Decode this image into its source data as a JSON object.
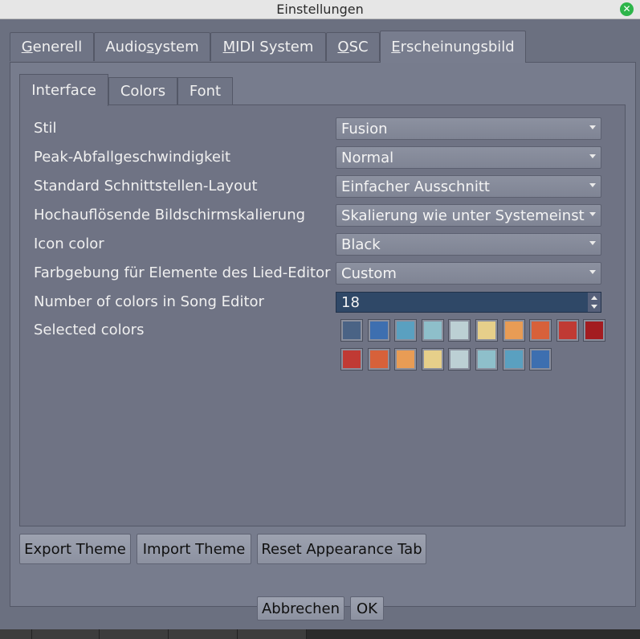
{
  "window": {
    "title": "Einstellungen"
  },
  "tabs": [
    {
      "label": "Generell",
      "accel_index": 0
    },
    {
      "label": "Audiosystem",
      "accel_index": 5
    },
    {
      "label": "MIDI System",
      "accel_index": 0
    },
    {
      "label": "OSC",
      "accel_index": 0
    },
    {
      "label": "Erscheinungsbild",
      "accel_index": 0,
      "active": true
    }
  ],
  "subtabs": [
    {
      "label": "Interface",
      "active": true
    },
    {
      "label": "Colors"
    },
    {
      "label": "Font"
    }
  ],
  "settings": {
    "style": {
      "label": "Stil",
      "value": "Fusion"
    },
    "peak_decay": {
      "label": "Peak-Abfallgeschwindigkeit",
      "value": "Normal"
    },
    "default_layout": {
      "label": "Standard Schnittstellen-Layout",
      "value": "Einfacher Ausschnitt"
    },
    "hidpi": {
      "label": "Hochauflösende Bildschirmskalierung",
      "value": "Skalierung wie unter Systemeinst"
    },
    "icon_color": {
      "label": "Icon color",
      "value": "Black"
    },
    "song_editor_coloring": {
      "label": "Farbgebung für Elemente des Lied-Editor",
      "value": "Custom"
    },
    "num_colors": {
      "label": "Number of colors in Song Editor",
      "value": "18"
    },
    "selected_colors": {
      "label": "Selected colors",
      "colors": [
        "#4a6385",
        "#3d6fb0",
        "#5aa0c0",
        "#8ebfca",
        "#bcd0d4",
        "#e6cf8a",
        "#e89c55",
        "#d7613a",
        "#c03a34",
        "#a31c20",
        "#c03a34",
        "#d7613a",
        "#e89c55",
        "#e6cf8a",
        "#bcd0d4",
        "#8ebfca",
        "#5aa0c0",
        "#3d6fb0"
      ]
    }
  },
  "buttons": {
    "export_theme": "Export Theme",
    "import_theme": "Import Theme",
    "reset_tab": "Reset Appearance Tab",
    "cancel": "Abbrechen",
    "ok": "OK"
  },
  "icons": {
    "close": "close-icon"
  }
}
